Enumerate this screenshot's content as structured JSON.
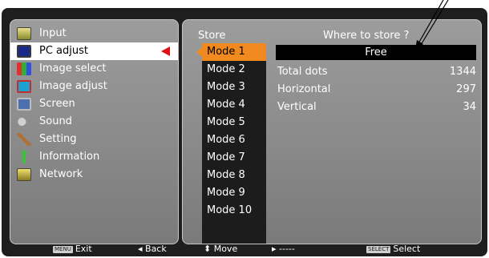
{
  "menu": {
    "items": [
      {
        "label": "Input",
        "icon": "input-icon"
      },
      {
        "label": "PC adjust",
        "icon": "pc-adjust-icon"
      },
      {
        "label": "Image select",
        "icon": "image-select-icon"
      },
      {
        "label": "Image adjust",
        "icon": "image-adjust-icon"
      },
      {
        "label": "Screen",
        "icon": "screen-icon"
      },
      {
        "label": "Sound",
        "icon": "sound-icon"
      },
      {
        "label": "Setting",
        "icon": "setting-icon"
      },
      {
        "label": "Information",
        "icon": "information-icon"
      },
      {
        "label": "Network",
        "icon": "network-icon"
      }
    ],
    "selected_index": 1
  },
  "store": {
    "title": "Store",
    "where_label": "Where to store ?",
    "modes": [
      "Mode 1",
      "Mode 2",
      "Mode 3",
      "Mode 4",
      "Mode 5",
      "Mode 6",
      "Mode 7",
      "Mode 8",
      "Mode 9",
      "Mode 10"
    ],
    "selected_mode_index": 0,
    "free_label": "Free",
    "info": {
      "total_dots_label": "Total dots",
      "total_dots_value": "1344",
      "horizontal_label": "Horizontal",
      "horizontal_value": "297",
      "vertical_label": "Vertical",
      "vertical_value": "34"
    }
  },
  "footer": {
    "menu_key": "MENU",
    "exit": "Exit",
    "back": "◂ Back",
    "move": "⬍ Move",
    "dash": "▸ -----",
    "select_key": "SELECT",
    "select": "Select"
  },
  "colors": {
    "accent": "#f08a20",
    "pointer": "#e01010",
    "panel": "#8a8a8a",
    "frame": "#1e1e1e"
  }
}
